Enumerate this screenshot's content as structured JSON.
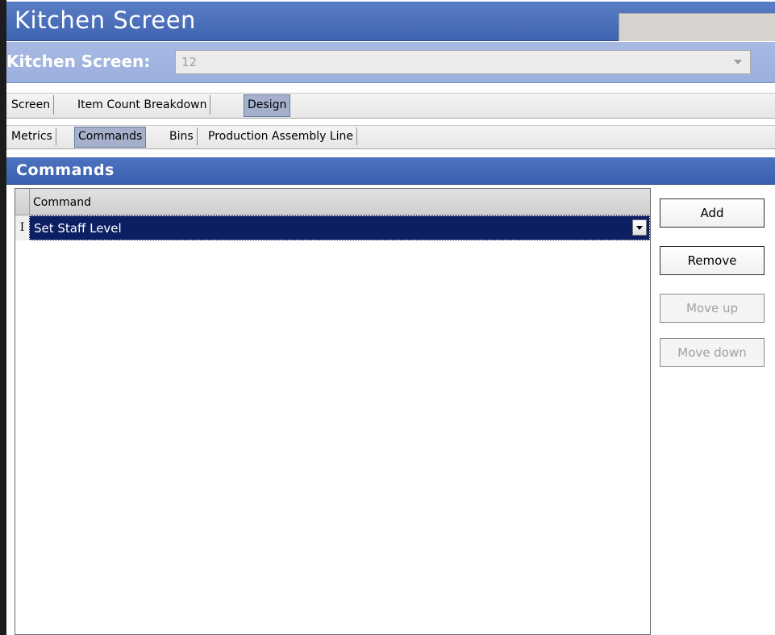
{
  "window": {
    "title": "Kitchen Screen"
  },
  "selector": {
    "label": "Kitchen Screen:",
    "value": "12"
  },
  "main_tabs": [
    {
      "label": "Screen",
      "active": false
    },
    {
      "label": "Item Count Breakdown",
      "active": false
    },
    {
      "label": "Design",
      "active": true
    }
  ],
  "sub_tabs": [
    {
      "label": "Metrics",
      "active": false
    },
    {
      "label": "Commands",
      "active": true
    },
    {
      "label": "Bins",
      "active": false
    },
    {
      "label": "Production Assembly Line",
      "active": false
    }
  ],
  "section": {
    "title": "Commands"
  },
  "grid": {
    "columns": [
      "Command"
    ],
    "rows": [
      {
        "indicator": "I",
        "command": "Set Staff Level",
        "selected": true
      }
    ]
  },
  "buttons": {
    "add": "Add",
    "remove": "Remove",
    "move_up": "Move up",
    "move_down": "Move down"
  },
  "colors": {
    "title_bar": "#3f64b0",
    "selector_bar": "#9cb0de",
    "selected_row": "#0b1f62",
    "active_tab": "#a4b0cc"
  },
  "icons": {
    "selector_dropdown": "chevron-down-icon",
    "row_dropdown": "dropdown-arrow-icon",
    "row_indicator": "text-cursor-icon"
  }
}
